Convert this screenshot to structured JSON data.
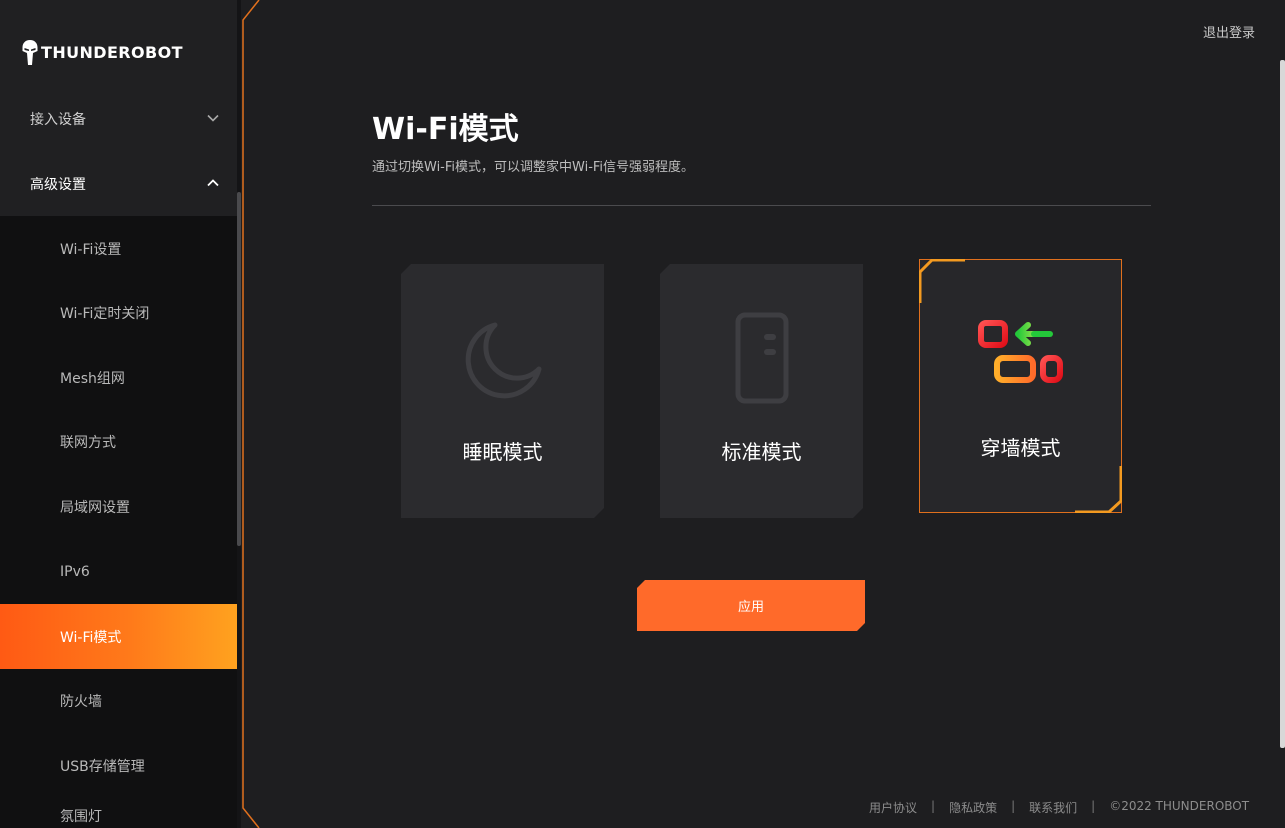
{
  "brand": {
    "name": "THUNDEROBOT"
  },
  "header": {
    "logout_label": "退出登录"
  },
  "sidebar": {
    "groups": [
      {
        "label": "接入设备",
        "expanded": false
      },
      {
        "label": "高级设置",
        "expanded": true
      }
    ],
    "sub_items": [
      {
        "label": "Wi-Fi设置",
        "active": false
      },
      {
        "label": "Wi-Fi定时关闭",
        "active": false
      },
      {
        "label": "Mesh组网",
        "active": false
      },
      {
        "label": "联网方式",
        "active": false
      },
      {
        "label": "局域网设置",
        "active": false
      },
      {
        "label": "IPv6",
        "active": false
      },
      {
        "label": "Wi-Fi模式",
        "active": true
      },
      {
        "label": "防火墙",
        "active": false
      },
      {
        "label": "USB存储管理",
        "active": false
      },
      {
        "label": "氛围灯",
        "active": false
      }
    ]
  },
  "main": {
    "title": "Wi-Fi模式",
    "description": "通过切换Wi-Fi模式，可以调整家中Wi-Fi信号强弱程度。",
    "modes": [
      {
        "label": "睡眠模式",
        "icon": "moon-icon",
        "selected": false
      },
      {
        "label": "标准模式",
        "icon": "router-icon",
        "selected": false
      },
      {
        "label": "穿墙模式",
        "icon": "wall-through-icon",
        "selected": true
      }
    ],
    "apply_label": "应用"
  },
  "footer": {
    "links": [
      "用户协议",
      "隐私政策",
      "联系我们"
    ],
    "copyright": "©2022 THUNDEROBOT"
  },
  "colors": {
    "accent": "#ff6a2a",
    "accent_gradient_end": "#ffa21f",
    "background": "#1e1e20",
    "sidebar_sub_bg": "#101011",
    "card_bg": "#2b2b2e"
  }
}
